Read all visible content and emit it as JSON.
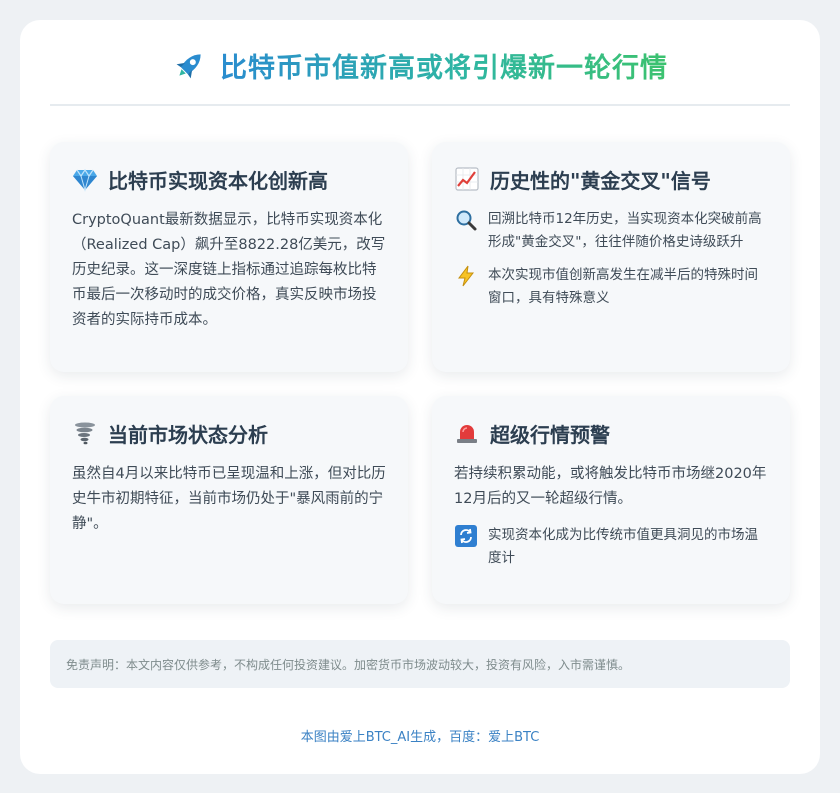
{
  "header": {
    "title": "比特币市值新高或将引爆新一轮行情",
    "icon": "rocket-icon"
  },
  "sections": [
    {
      "icon": "gem-icon",
      "title": "比特币实现资本化创新高",
      "body": "CryptoQuant最新数据显示，比特币实现资本化（Realized Cap）飙升至8822.28亿美元，改写历史纪录。这一深度链上指标通过追踪每枚比特币最后一次移动时的成交价格，真实反映市场投资者的实际持币成本。"
    },
    {
      "icon": "chart-increasing-icon",
      "title": "历史性的\"黄金交叉\"信号",
      "bullets": [
        {
          "icon": "magnifier-icon",
          "text": "回溯比特币12年历史，当实现资本化突破前高形成\"黄金交叉\"，往往伴随价格史诗级跃升"
        },
        {
          "icon": "lightning-icon",
          "text": "本次实现市值创新高发生在减半后的特殊时间窗口，具有特殊意义"
        }
      ]
    },
    {
      "icon": "tornado-icon",
      "title": "当前市场状态分析",
      "body": "虽然自4月以来比特币已呈现温和上涨，但对比历史牛市初期特征，当前市场仍处于\"暴风雨前的宁静\"。"
    },
    {
      "icon": "siren-icon",
      "title": "超级行情预警",
      "body": "若持续积累动能，或将触发比特币市场继2020年12月后的又一轮超级行情。",
      "bullets": [
        {
          "icon": "refresh-icon",
          "text": "实现资本化成为比传统市值更具洞见的市场温度计"
        }
      ]
    }
  ],
  "disclaimer": "免责声明：本文内容仅供参考，不构成任何投资建议。加密货币市场波动较大，投资有风险，入市需谨慎。",
  "footer": "本图由爱上BTC_AI生成，百度：爱上BTC",
  "colors": {
    "title_start": "#2a8ccf",
    "title_end": "#3cc26f",
    "footer_link": "#3b82c4",
    "panel_bg": "#f6f8fa"
  }
}
